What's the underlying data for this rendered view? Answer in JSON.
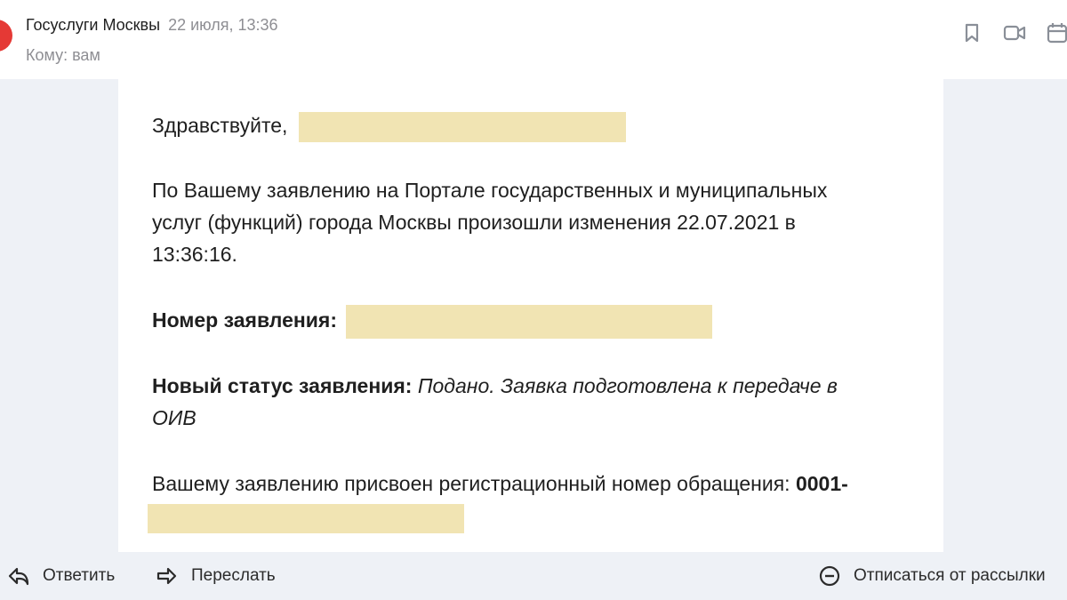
{
  "header": {
    "sender": "Госуслуги Москвы",
    "date": "22 июля, 13:36",
    "to": "Кому: вам",
    "icons": [
      "bookmark-icon",
      "video-call-icon",
      "calendar-icon"
    ]
  },
  "message": {
    "greeting": "Здравствуйте,",
    "para1_line1": "По Вашему заявлению на Портале государственных и муниципальных",
    "para1_line2": "услуг (функций) города Москвы произошли изменения 22.07.2021 в",
    "para1_line3": "13:36:16.",
    "number_label": "Номер заявления:",
    "status_label": "Новый статус заявления:",
    "status_value_line1": "Подано. Заявка подготовлена к передаче в",
    "status_value_line2": "ОИВ",
    "reg_text": "Вашему заявлению присвоен регистрационный номер обращения:",
    "reg_number_prefix": "0001-"
  },
  "actions": {
    "reply": "Ответить",
    "forward": "Переслать",
    "unsubscribe": "Отписаться от рассылки"
  },
  "colors": {
    "accent_red": "#e53935",
    "redaction": "#f1e4b3",
    "background": "#eef1f6"
  }
}
